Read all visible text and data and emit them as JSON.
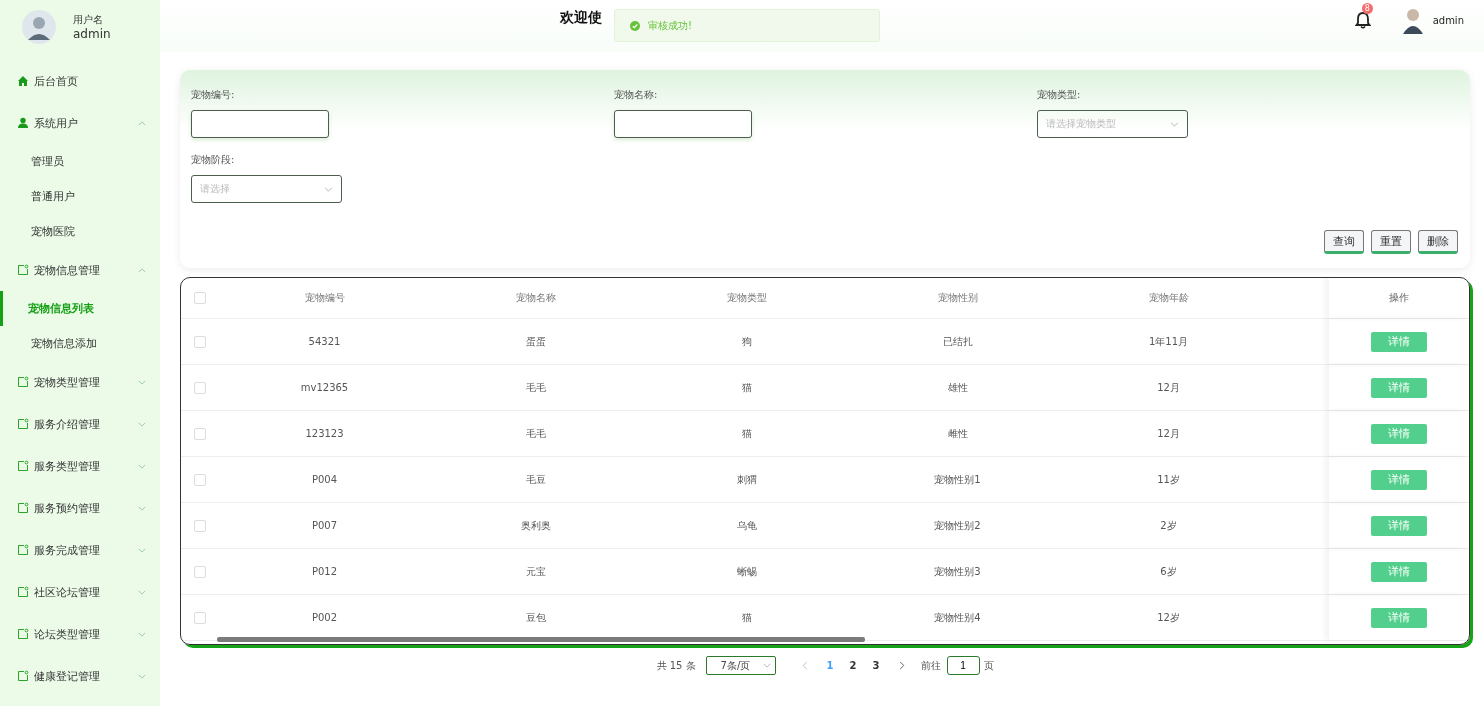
{
  "user": {
    "label": "用户名",
    "name": "admin"
  },
  "sidebar": {
    "items": [
      {
        "label": "后台首页",
        "kind": "home"
      },
      {
        "label": "系统用户",
        "kind": "user",
        "expanded": true,
        "children": [
          {
            "label": "管理员",
            "selected": false
          },
          {
            "label": "普通用户",
            "selected": false
          },
          {
            "label": "宠物医院",
            "selected": false
          }
        ]
      },
      {
        "label": "宠物信息管理",
        "kind": "folder",
        "expanded": true,
        "children": [
          {
            "label": "宠物信息列表",
            "selected": true
          },
          {
            "label": "宠物信息添加",
            "selected": false
          }
        ]
      },
      {
        "label": "宠物类型管理",
        "kind": "folder",
        "expanded": false
      },
      {
        "label": "服务介绍管理",
        "kind": "folder",
        "expanded": false
      },
      {
        "label": "服务类型管理",
        "kind": "folder",
        "expanded": false
      },
      {
        "label": "服务预约管理",
        "kind": "folder",
        "expanded": false
      },
      {
        "label": "服务完成管理",
        "kind": "folder",
        "expanded": false
      },
      {
        "label": "社区论坛管理",
        "kind": "folder",
        "expanded": false
      },
      {
        "label": "论坛类型管理",
        "kind": "folder",
        "expanded": false
      },
      {
        "label": "健康登记管理",
        "kind": "folder",
        "expanded": false
      }
    ]
  },
  "header": {
    "title": "欢迎使",
    "notification_count": "8",
    "user": "admin"
  },
  "toast": {
    "kind": "success",
    "text": "审核成功!"
  },
  "search": {
    "fields": [
      {
        "label": "宠物编号:",
        "kind": "input"
      },
      {
        "label": "宠物名称:",
        "kind": "input"
      },
      {
        "label": "宠物类型:",
        "kind": "select",
        "placeholder": "请选择宠物类型"
      },
      {
        "label": "宠物阶段:",
        "kind": "select",
        "placeholder": "请选择"
      }
    ],
    "buttons": [
      "查询",
      "重置",
      "删除"
    ]
  },
  "table": {
    "header_checked": false,
    "columns": [
      "宠物编号",
      "宠物名称",
      "宠物类型",
      "宠物性别",
      "宠物年龄",
      "操作"
    ],
    "rows": [
      {
        "checked": false,
        "cells": [
          "54321",
          "蛋蛋",
          "狗",
          "已结扎",
          "1年11月"
        ],
        "action": "详情"
      },
      {
        "checked": false,
        "cells": [
          "mv12365",
          "毛毛",
          "猫",
          "雄性",
          "12月"
        ],
        "action": "详情"
      },
      {
        "checked": false,
        "cells": [
          "123123",
          "毛毛",
          "猫",
          "雌性",
          "12月"
        ],
        "action": "详情"
      },
      {
        "checked": false,
        "cells": [
          "P004",
          "毛豆",
          "刺猬",
          "宠物性别1",
          "11岁"
        ],
        "action": "详情"
      },
      {
        "checked": false,
        "cells": [
          "P007",
          "奥利奥",
          "乌龟",
          "宠物性别2",
          "2岁"
        ],
        "action": "详情"
      },
      {
        "checked": false,
        "cells": [
          "P012",
          "元宝",
          "蜥蜴",
          "宠物性别3",
          "6岁"
        ],
        "action": "详情"
      },
      {
        "checked": false,
        "cells": [
          "P002",
          "豆包",
          "猫",
          "宠物性别4",
          "12岁"
        ],
        "action": "详情"
      }
    ]
  },
  "pagination": {
    "total": "共 15 条",
    "page_size": "7条/页",
    "pages": [
      {
        "label": "1",
        "selected": true
      },
      {
        "label": "2",
        "selected": false
      },
      {
        "label": "3",
        "selected": false
      }
    ],
    "goto_label": "前往",
    "goto_value": "1",
    "goto_suffix": "页"
  }
}
